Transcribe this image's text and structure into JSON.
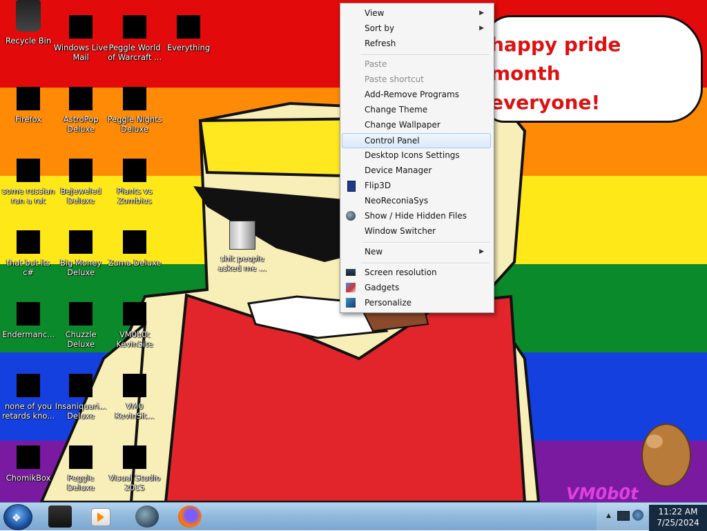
{
  "speech": {
    "line1": "happy pride month",
    "line2": "everyone!"
  },
  "watermark": "VM0b0t",
  "desktop_icons": [
    {
      "label": "Recycle Bin"
    },
    {
      "label": "Windows Live Mail"
    },
    {
      "label": "Peggle World of Warcraft ..."
    },
    {
      "label": "Everything"
    },
    {
      "label": "Firefox"
    },
    {
      "label": "AstroPop Deluxe"
    },
    {
      "label": "Peggle Nights Deluxe"
    },
    {
      "label": "some russian ran a rat"
    },
    {
      "label": "Bejeweled Deluxe"
    },
    {
      "label": "Plants vs Zombies"
    },
    {
      "label": "that but its c#"
    },
    {
      "label": "Big Money Deluxe"
    },
    {
      "label": "Zuma Deluxe"
    },
    {
      "label": "shit people asked me ..."
    },
    {
      "label": "Endermanc..."
    },
    {
      "label": "Chuzzle Deluxe"
    },
    {
      "label": "VM0b0t KevinSite"
    },
    {
      "label": "none of you retards kno..."
    },
    {
      "label": "Insaniquari... Deluxe"
    },
    {
      "label": "VM0 KevinSit..."
    },
    {
      "label": "ChomikBox"
    },
    {
      "label": "Peggle Deluxe"
    },
    {
      "label": "Visual Studio 2015"
    }
  ],
  "context_menu": {
    "items": [
      {
        "label": "View"
      },
      {
        "label": "Sort by"
      },
      {
        "label": "Refresh"
      },
      {
        "label": "Paste"
      },
      {
        "label": "Paste shortcut"
      },
      {
        "label": "Add-Remove Programs"
      },
      {
        "label": "Change Theme"
      },
      {
        "label": "Change Wallpaper"
      },
      {
        "label": "Control Panel"
      },
      {
        "label": "Desktop Icons Settings"
      },
      {
        "label": "Device Manager"
      },
      {
        "label": "Flip3D"
      },
      {
        "label": "NeoReconiaSys"
      },
      {
        "label": "Show / Hide Hidden Files"
      },
      {
        "label": "Window Switcher"
      },
      {
        "label": "New"
      },
      {
        "label": "Screen resolution"
      },
      {
        "label": "Gadgets"
      },
      {
        "label": "Personalize"
      }
    ]
  },
  "clock": {
    "time": "11:22 AM",
    "date": "7/25/2024"
  }
}
